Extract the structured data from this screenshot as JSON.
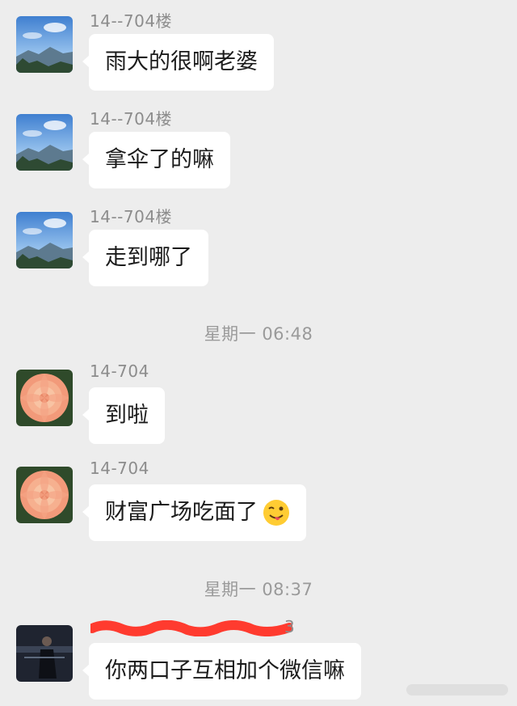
{
  "messages": [
    {
      "sender": "14--704楼",
      "text": "雨大的很啊老婆",
      "avatar": "mountain-landscape-avatar"
    },
    {
      "sender": "14--704楼",
      "text": "拿伞了的嘛",
      "avatar": "mountain-landscape-avatar"
    },
    {
      "sender": "14--704楼",
      "text": "走到哪了",
      "avatar": "mountain-landscape-avatar"
    },
    {
      "timestamp": "星期一 06:48"
    },
    {
      "sender": "14-704",
      "text": "到啦",
      "avatar": "flower-avatar"
    },
    {
      "sender": "14-704",
      "text": "财富广场吃面了",
      "emoji": "winking-tongue-emoji",
      "avatar": "flower-avatar"
    },
    {
      "timestamp": "星期一 08:37"
    },
    {
      "sender": "3",
      "sender_redacted": true,
      "text": "你两口子互相加个微信嘛",
      "avatar": "person-photo-avatar"
    }
  ],
  "colors": {
    "background": "#ededed",
    "bubble": "#ffffff",
    "sender_text": "#8c8c8c",
    "timestamp_text": "#9a9a9a",
    "redaction": "#ff3b2f"
  }
}
